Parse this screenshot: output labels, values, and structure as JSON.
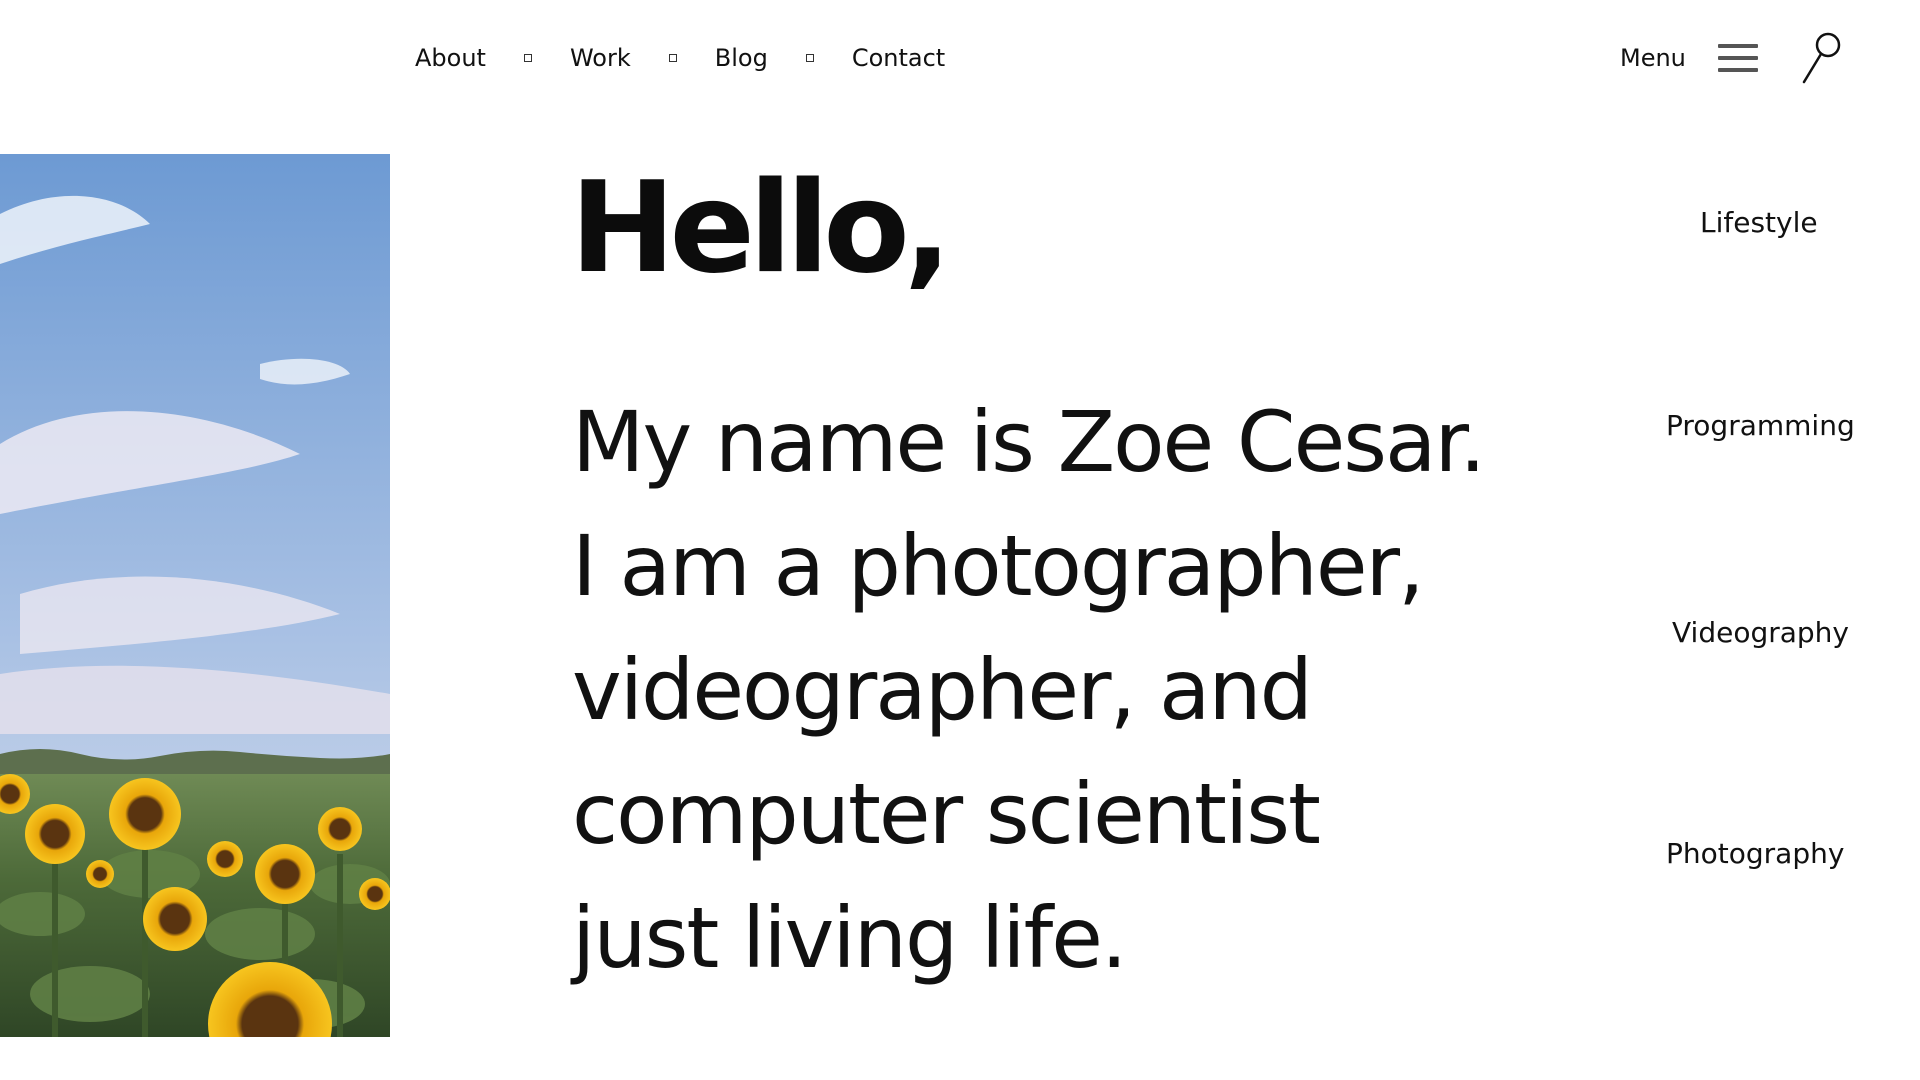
{
  "nav": {
    "items": [
      {
        "label": "About"
      },
      {
        "label": "Work"
      },
      {
        "label": "Blog"
      },
      {
        "label": "Contact"
      }
    ],
    "menu_label": "Menu",
    "icons": {
      "menu": "hamburger-icon",
      "search": "search-icon"
    }
  },
  "hero": {
    "image": "sunflower-field-photo",
    "greeting": "Hello,",
    "lines": [
      "My name is Zoe Cesar.",
      "I am a photographer,",
      "videographer, and",
      "computer scientist",
      "just living life."
    ]
  },
  "categories": [
    {
      "label": "Lifestyle"
    },
    {
      "label": "Programming"
    },
    {
      "label": "Videography"
    },
    {
      "label": "Photography"
    }
  ],
  "colors": {
    "text": "#111111",
    "background": "#ffffff",
    "sky": "#7aa3d8",
    "sunflower": "#f2b705",
    "foliage": "#4f6b3a"
  }
}
